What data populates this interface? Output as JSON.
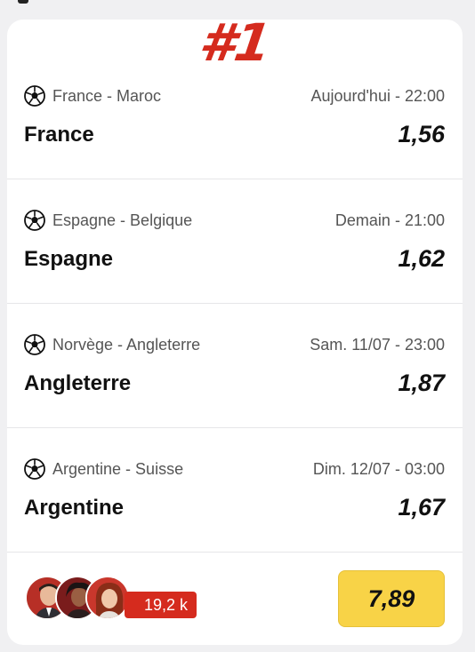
{
  "rank": "#1",
  "matches": [
    {
      "teams": "France - Maroc",
      "time": "Aujourd'hui - 22:00",
      "pick": "France",
      "odd": "1,56"
    },
    {
      "teams": "Espagne - Belgique",
      "time": "Demain - 21:00",
      "pick": "Espagne",
      "odd": "1,62"
    },
    {
      "teams": "Norvège - Angleterre",
      "time": "Sam. 11/07 - 23:00",
      "pick": "Angleterre",
      "odd": "1,87"
    },
    {
      "teams": "Argentine - Suisse",
      "time": "Dim. 12/07 - 03:00",
      "pick": "Argentine",
      "odd": "1,67"
    }
  ],
  "footer": {
    "followers": "19,2 k",
    "total_odd": "7,89"
  },
  "colors": {
    "brand_red": "#d52b1e",
    "odd_button": "#f8d347"
  },
  "icons": {
    "sport": "soccer-ball-icon"
  }
}
